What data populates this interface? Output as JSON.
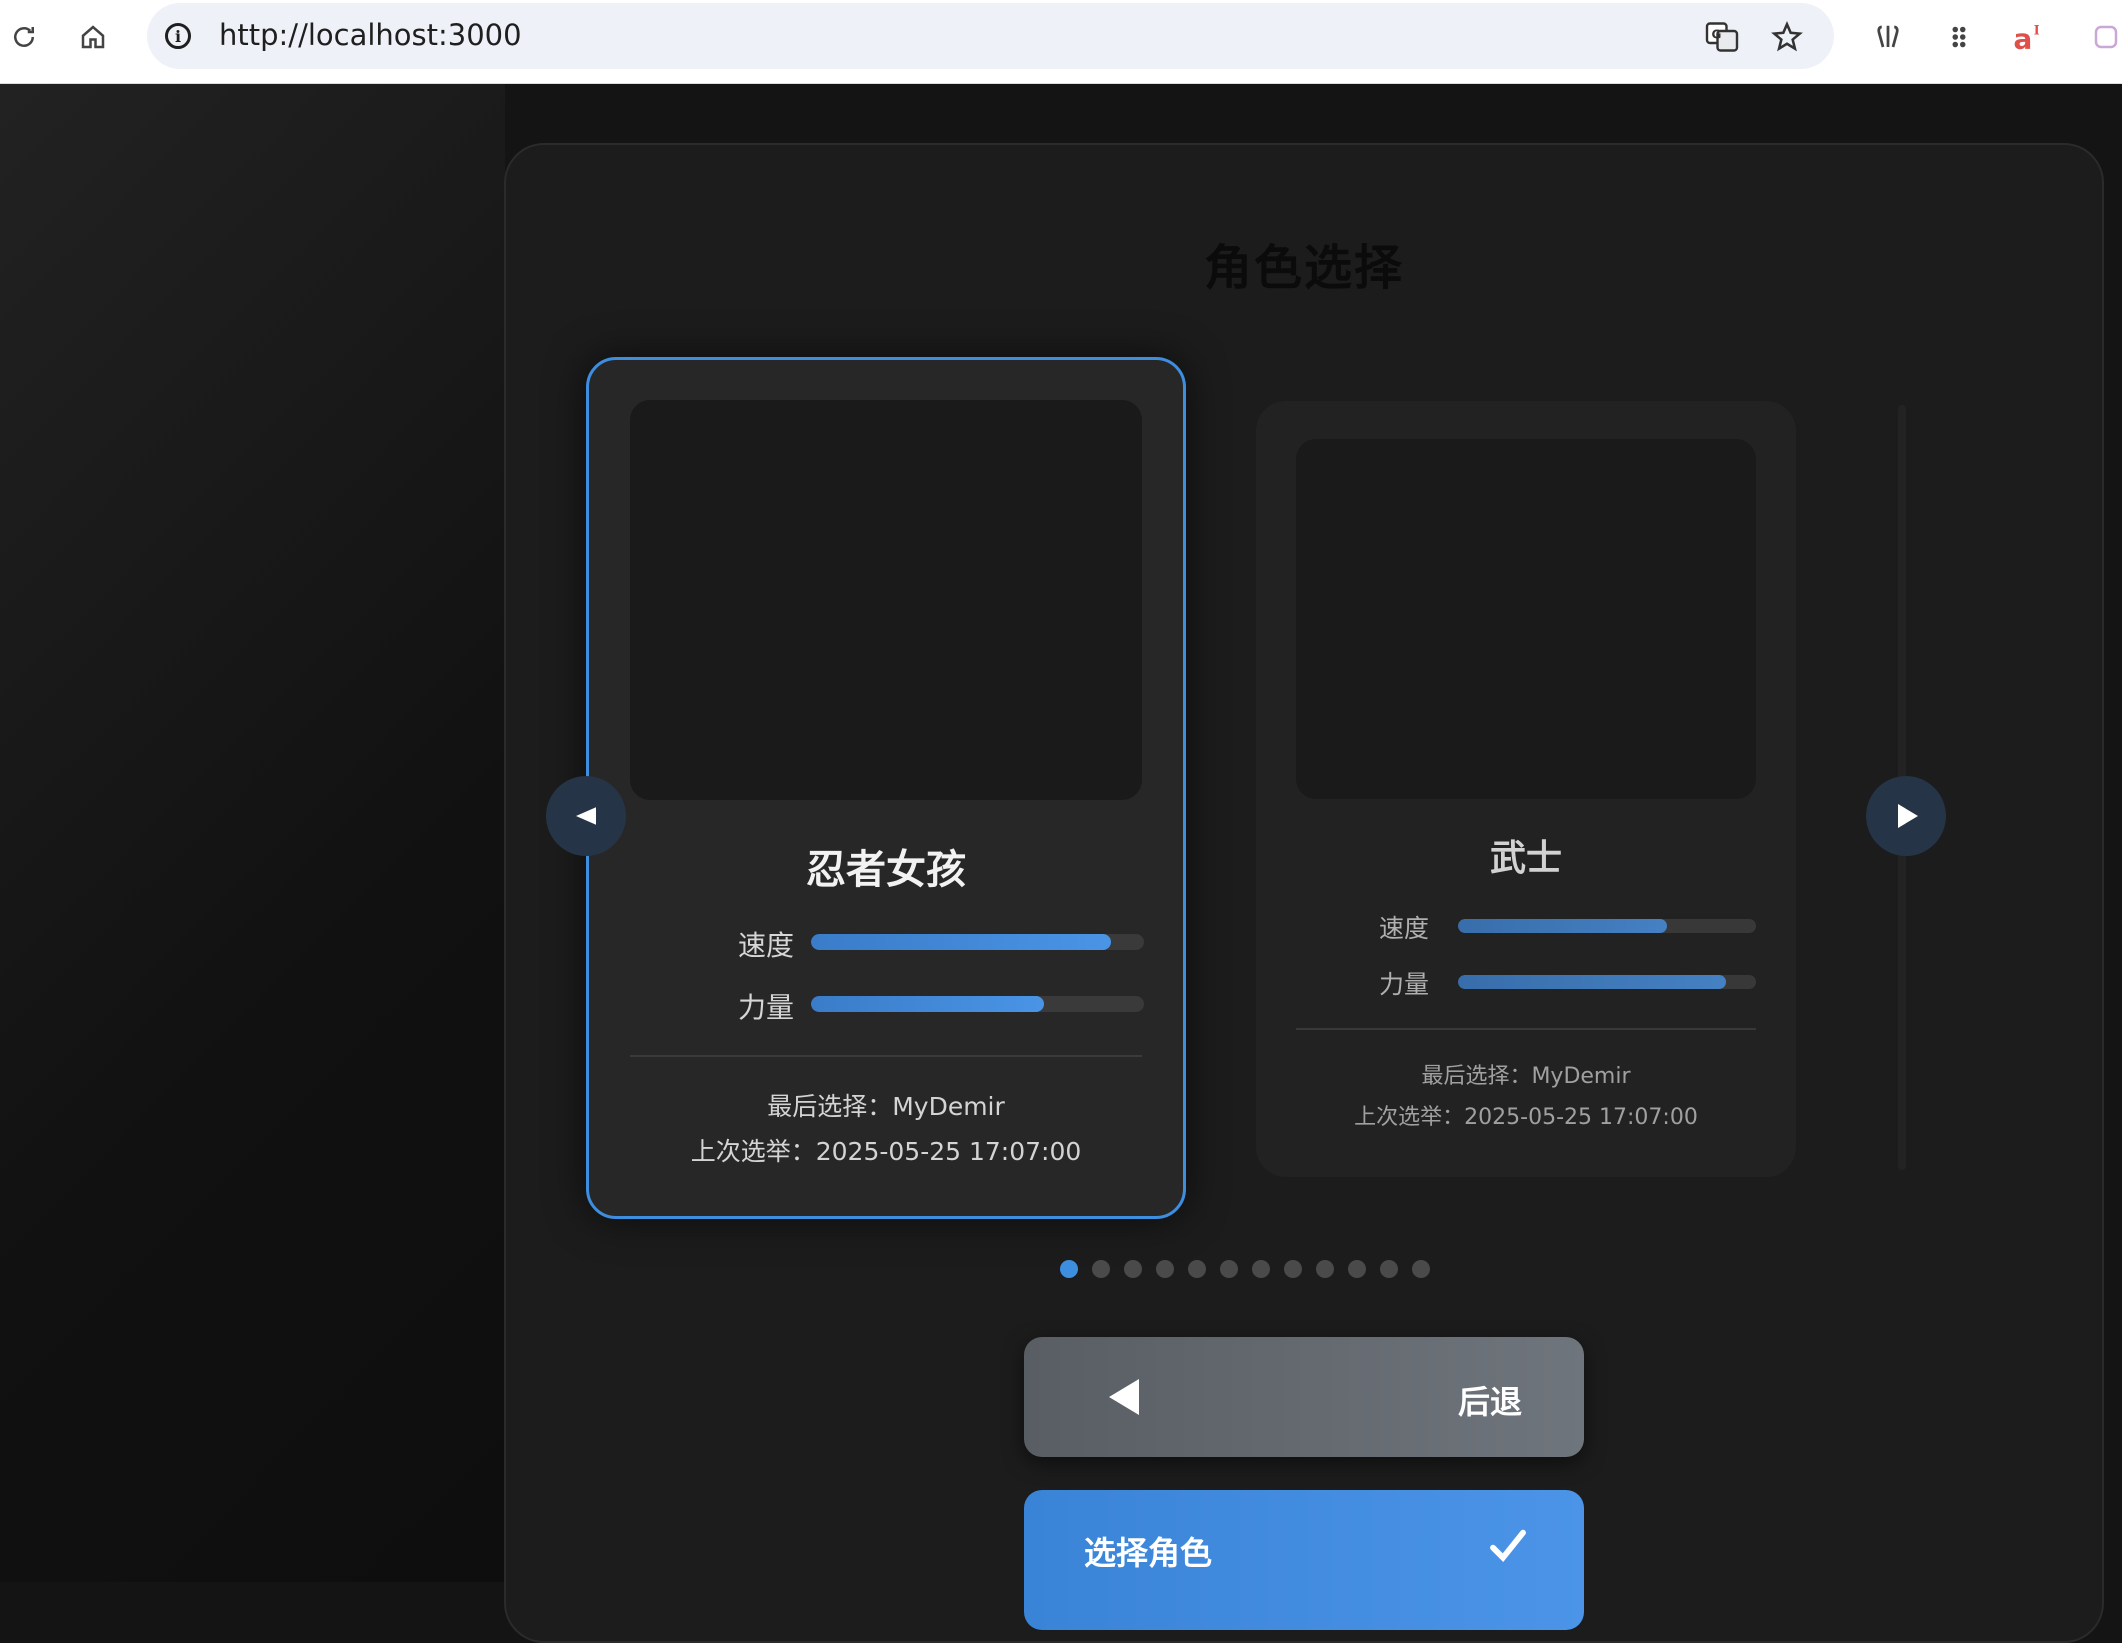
{
  "browser": {
    "url": "http://localhost:3000"
  },
  "page": {
    "title": "角色选择"
  },
  "characters": [
    {
      "name": "忍者女孩",
      "stats": [
        {
          "label": "速度",
          "value": 0.9
        },
        {
          "label": "力量",
          "value": 0.7
        }
      ],
      "last_selected": "最后选择：MyDemir",
      "last_election": "上次选举：2025-05-25 17:07:00"
    },
    {
      "name": "武士",
      "stats": [
        {
          "label": "速度",
          "value": 0.7
        },
        {
          "label": "力量",
          "value": 0.9
        }
      ],
      "last_selected": "最后选择：MyDemir",
      "last_election": "上次选举：2025-05-25 17:07:00"
    }
  ],
  "carousel": {
    "page_count": 12,
    "active_index": 0
  },
  "actions": {
    "back_label": "后退",
    "select_label": "选择角色"
  },
  "colors": {
    "accent": "#3e8ee0",
    "back_button": "#6a7077"
  }
}
